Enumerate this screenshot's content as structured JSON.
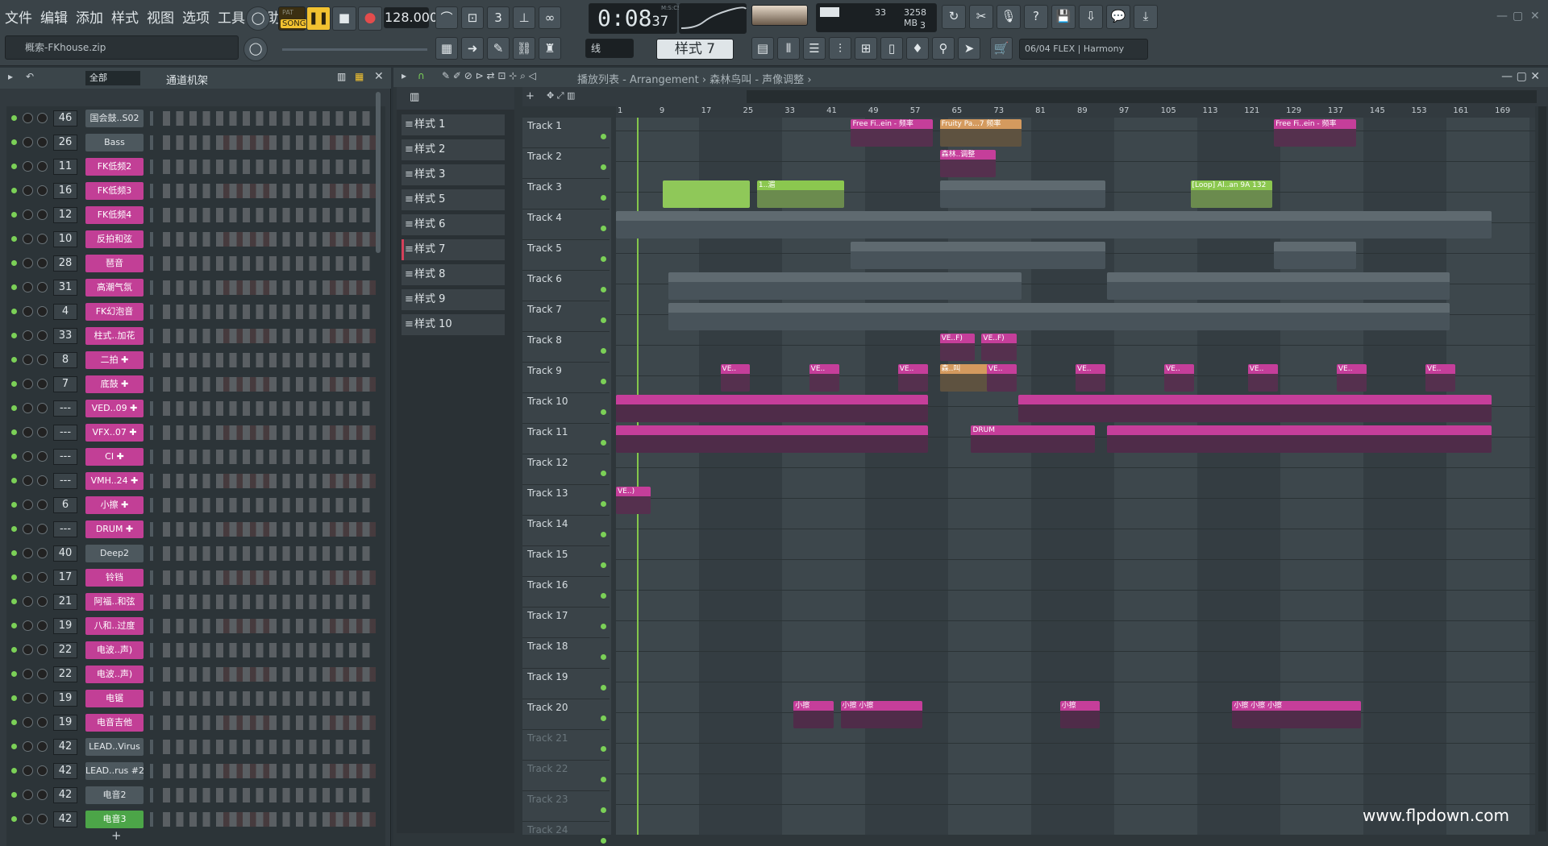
{
  "menu": [
    "文件",
    "编辑",
    "添加",
    "样式",
    "视图",
    "选项",
    "工具",
    "帮助"
  ],
  "transport": {
    "pat_label": "PAT",
    "song_label": "SONG",
    "tempo": "128.000",
    "time_main": "0:08",
    "time_sub": "37",
    "time_unit": "M:S:CS"
  },
  "cpu": {
    "value": "33",
    "memory": "3258 MB",
    "polyphony": "3"
  },
  "hint": "概索-FKhouse.zip",
  "snap": "线",
  "pattern_selector": "样式 7",
  "plugin_info": "06/04  FLEX | Harmony",
  "rack": {
    "filter": "全部",
    "title": "通道机架",
    "add_symbol": "+",
    "channels": [
      {
        "num": "46",
        "name": "国会鼓..S02",
        "style": "gray"
      },
      {
        "num": "26",
        "name": "Bass",
        "style": "gray"
      },
      {
        "num": "11",
        "name": "FK低频2",
        "style": "pink"
      },
      {
        "num": "16",
        "name": "FK低频3",
        "style": "pink"
      },
      {
        "num": "12",
        "name": "FK低频4",
        "style": "pink"
      },
      {
        "num": "10",
        "name": "反拍和弦",
        "style": "pink"
      },
      {
        "num": "28",
        "name": "琶音",
        "style": "pink"
      },
      {
        "num": "31",
        "name": "高潮气氛",
        "style": "pink"
      },
      {
        "num": "4",
        "name": "FK幻泡音",
        "style": "pink"
      },
      {
        "num": "33",
        "name": "柱式..加花",
        "style": "pink"
      },
      {
        "num": "8",
        "name": "二拍 ✚",
        "style": "pink"
      },
      {
        "num": "7",
        "name": "底鼓 ✚",
        "style": "pink"
      },
      {
        "num": "---",
        "name": "VED..09 ✚",
        "style": "pink"
      },
      {
        "num": "---",
        "name": "VFX..07 ✚",
        "style": "pink"
      },
      {
        "num": "---",
        "name": "CI ✚",
        "style": "pink"
      },
      {
        "num": "---",
        "name": "VMH..24 ✚",
        "style": "pink"
      },
      {
        "num": "6",
        "name": "小擦 ✚",
        "style": "pink"
      },
      {
        "num": "---",
        "name": "DRUM ✚",
        "style": "pink"
      },
      {
        "num": "40",
        "name": "Deep2",
        "style": "gray"
      },
      {
        "num": "17",
        "name": "铃铛",
        "style": "pink"
      },
      {
        "num": "21",
        "name": "阿福..和弦",
        "style": "pink"
      },
      {
        "num": "19",
        "name": "八和..过度",
        "style": "pink"
      },
      {
        "num": "22",
        "name": "电波..声)",
        "style": "pink"
      },
      {
        "num": "22",
        "name": "电波..声)",
        "style": "pink"
      },
      {
        "num": "19",
        "name": "电锯",
        "style": "pink"
      },
      {
        "num": "19",
        "name": "电音吉他",
        "style": "pink"
      },
      {
        "num": "42",
        "name": "LEAD..Virus",
        "style": "gray"
      },
      {
        "num": "42",
        "name": "LEAD..rus #2",
        "style": "gray"
      },
      {
        "num": "42",
        "name": "电音2",
        "style": "gray"
      },
      {
        "num": "42",
        "name": "电音3",
        "style": "green"
      }
    ]
  },
  "playlist": {
    "breadcrumb": "播放列表 - Arrangement › 森林鸟叫 - 声像调整 ›",
    "add_symbol": "+",
    "patterns": [
      "样式 1",
      "样式 2",
      "样式 3",
      "样式 5",
      "样式 6",
      "样式 7",
      "样式 8",
      "样式 9",
      "样式 10"
    ],
    "selected_pattern": "样式 7",
    "bars": [
      "1",
      "9",
      "17",
      "25",
      "33",
      "41",
      "49",
      "57",
      "65",
      "73",
      "81",
      "89",
      "97",
      "105",
      "113",
      "121",
      "129",
      "137",
      "145",
      "153",
      "161",
      "169"
    ],
    "tracks": [
      "Track 1",
      "Track 2",
      "Track 3",
      "Track 4",
      "Track 5",
      "Track 6",
      "Track 7",
      "Track 8",
      "Track 9",
      "Track 10",
      "Track 11",
      "Track 12",
      "Track 13",
      "Track 14",
      "Track 15",
      "Track 16",
      "Track 17",
      "Track 18",
      "Track 19",
      "Track 20",
      "Track 21",
      "Track 22",
      "Track 23",
      "Track 24"
    ],
    "clips": [
      {
        "track": 1,
        "start": 45,
        "len": 16,
        "label": "Free Fi..ein - 频率",
        "style": "pink"
      },
      {
        "track": 1,
        "start": 62,
        "len": 16,
        "label": "Fruity Pa...7 频率",
        "style": "tan"
      },
      {
        "track": 1,
        "start": 126,
        "len": 16,
        "label": "Free Fi..ein - 频率",
        "style": "pink"
      },
      {
        "track": 2,
        "start": 62,
        "len": 11,
        "label": "森林..调整",
        "style": "pink"
      },
      {
        "track": 3,
        "start": 9,
        "len": 17,
        "label": "",
        "style": "lime"
      },
      {
        "track": 3,
        "start": 27,
        "len": 17,
        "label": "1..湄",
        "style": "green"
      },
      {
        "track": 3,
        "start": 62,
        "len": 32,
        "label": "",
        "style": "gray"
      },
      {
        "track": 3,
        "start": 110,
        "len": 16,
        "label": "[Loop] Al..an 9A 132",
        "style": "green"
      },
      {
        "track": 4,
        "start": 0,
        "len": 168,
        "label": "",
        "style": "gray"
      },
      {
        "track": 5,
        "start": 45,
        "len": 49,
        "label": "",
        "style": "gray"
      },
      {
        "track": 5,
        "start": 126,
        "len": 16,
        "label": "",
        "style": "gray"
      },
      {
        "track": 6,
        "start": 10,
        "len": 68,
        "label": "",
        "style": "gray"
      },
      {
        "track": 6,
        "start": 94,
        "len": 66,
        "label": "",
        "style": "gray"
      },
      {
        "track": 7,
        "start": 10,
        "len": 150,
        "label": "",
        "style": "gray"
      },
      {
        "track": 8,
        "start": 62,
        "len": 7,
        "label": "VE..F)",
        "style": "pink"
      },
      {
        "track": 8,
        "start": 70,
        "len": 7,
        "label": "VE..F)",
        "style": "pink"
      },
      {
        "track": 9,
        "start": 20,
        "len": 6,
        "label": "VE..",
        "style": "pink"
      },
      {
        "track": 9,
        "start": 37,
        "len": 6,
        "label": "VE..",
        "style": "pink"
      },
      {
        "track": 9,
        "start": 54,
        "len": 6,
        "label": "VE..",
        "style": "pink"
      },
      {
        "track": 9,
        "start": 62,
        "len": 10,
        "label": "森..叫",
        "style": "tan"
      },
      {
        "track": 9,
        "start": 71,
        "len": 6,
        "label": "VE..",
        "style": "pink"
      },
      {
        "track": 9,
        "start": 88,
        "len": 6,
        "label": "VE..",
        "style": "pink"
      },
      {
        "track": 9,
        "start": 105,
        "len": 6,
        "label": "VE..",
        "style": "pink"
      },
      {
        "track": 9,
        "start": 121,
        "len": 6,
        "label": "VE..",
        "style": "pink"
      },
      {
        "track": 9,
        "start": 138,
        "len": 6,
        "label": "VE..",
        "style": "pink"
      },
      {
        "track": 9,
        "start": 155,
        "len": 6,
        "label": "VE..",
        "style": "pink"
      },
      {
        "track": 10,
        "start": 0,
        "len": 60,
        "label": "",
        "style": "pinkw"
      },
      {
        "track": 10,
        "start": 77,
        "len": 91,
        "label": "",
        "style": "pinkw"
      },
      {
        "track": 11,
        "start": 0,
        "len": 60,
        "label": "",
        "style": "pinkw"
      },
      {
        "track": 11,
        "start": 68,
        "len": 24,
        "label": "DRUM",
        "style": "pinkw"
      },
      {
        "track": 11,
        "start": 94,
        "len": 74,
        "label": "",
        "style": "pinkw"
      },
      {
        "track": 13,
        "start": 0,
        "len": 7,
        "label": "VE..)",
        "style": "pink"
      },
      {
        "track": 20,
        "start": 34,
        "len": 8,
        "label": "小擦",
        "style": "pinkw"
      },
      {
        "track": 20,
        "start": 43,
        "len": 16,
        "label": "小擦 小擦",
        "style": "pinkw"
      },
      {
        "track": 20,
        "start": 85,
        "len": 8,
        "label": "小擦",
        "style": "pinkw"
      },
      {
        "track": 20,
        "start": 118,
        "len": 25,
        "label": "小擦 小擦 小擦",
        "style": "pinkw"
      }
    ]
  },
  "watermark": "www.flpdown.com"
}
